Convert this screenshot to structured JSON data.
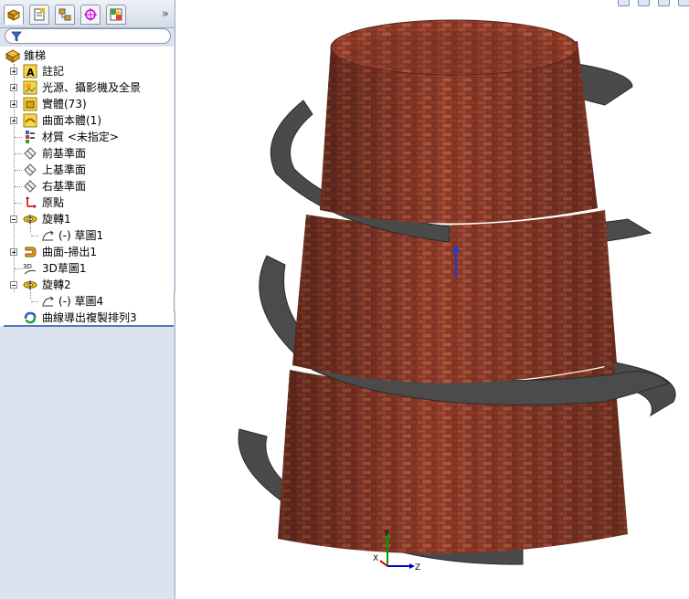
{
  "panel": {
    "tabs": [
      {
        "name": "featuremanager",
        "icon": "featuremanager-tab-icon",
        "active": true
      },
      {
        "name": "propertymanager",
        "icon": "propertymanager-tab-icon",
        "active": false
      },
      {
        "name": "configurationmanager",
        "icon": "configurationmanager-tab-icon",
        "active": false
      },
      {
        "name": "dimxpert",
        "icon": "dimxpert-tab-icon",
        "active": false
      },
      {
        "name": "display",
        "icon": "display-manager-tab-icon",
        "active": false
      }
    ],
    "expand_label": "»",
    "filter_icon": "filter-icon"
  },
  "tree": {
    "root": "錐梯",
    "items": [
      {
        "label": "註記",
        "icon": "annotations-icon"
      },
      {
        "label": "光源、攝影機及全景",
        "icon": "lights-cameras-icon"
      },
      {
        "label": "實體(73)",
        "icon": "solid-bodies-icon"
      },
      {
        "label": "曲面本體(1)",
        "icon": "surface-bodies-icon"
      },
      {
        "label": "材質 <未指定>",
        "icon": "material-icon"
      },
      {
        "label": "前基準面",
        "icon": "plane-icon"
      },
      {
        "label": "上基準面",
        "icon": "plane-icon"
      },
      {
        "label": "右基準面",
        "icon": "plane-icon"
      },
      {
        "label": "原點",
        "icon": "origin-icon"
      },
      {
        "label": "旋轉1",
        "icon": "revolve-icon"
      },
      {
        "label": "(-) 草圖1",
        "icon": "sketch-icon"
      },
      {
        "label": "曲面-掃出1",
        "icon": "surface-sweep-icon"
      },
      {
        "label": "3D草圖1",
        "icon": "3d-sketch-icon"
      },
      {
        "label": "旋轉2",
        "icon": "revolve-icon"
      },
      {
        "label": "(-) 草圖4",
        "icon": "sketch-icon"
      },
      {
        "label": "曲線導出複製排列3",
        "icon": "curve-pattern-icon"
      }
    ]
  },
  "viewport": {
    "triad": {
      "x": "X",
      "y": "Y",
      "z": "Z"
    },
    "colors": {
      "brick": "#8c3a2a",
      "step": "#4a4a4a",
      "triad_x": "#cc0000",
      "triad_y": "#00a000",
      "triad_z": "#0000cc"
    }
  }
}
